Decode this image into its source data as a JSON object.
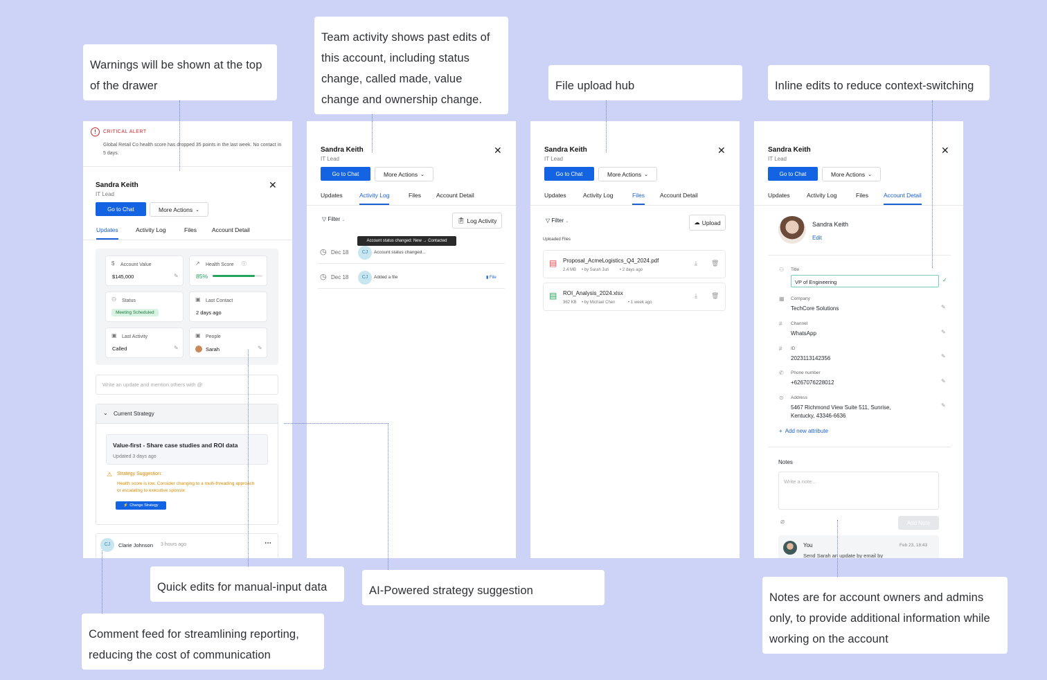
{
  "callouts": {
    "warnings": "Warnings will be shown at the top of the drawer",
    "team_activity": "Team activity shows past edits of this account, including status change, called made, value change and ownership change.",
    "file_hub": "File upload hub",
    "inline_edits": "Inline edits to reduce context-switching",
    "quick_edits": "Quick edits for manual-input data",
    "ai_strategy": "AI-Powered strategy suggestion",
    "comment_feed": "Comment feed for streamlining reporting, reducing the cost of communication",
    "notes": "Notes are for account owners and admins only, to provide additional information while working on the account"
  },
  "common": {
    "name": "Sandra Keith",
    "role": "IT Lead",
    "go_to_chat": "Go to Chat",
    "more_actions": "More Actions",
    "tabs": [
      "Updates",
      "Activity Log",
      "Files",
      "Account Detail"
    ]
  },
  "panel1": {
    "alert_title": "CRITICAL ALERT",
    "alert_text": "Global Retail Co health score has dropped 35 points in the last week. No contact in 5 days.",
    "metrics": {
      "account_value_label": "Account Value",
      "account_value": "$145,000",
      "health_label": "Health Score",
      "health_value": "85%",
      "health_fraction": 0.85,
      "status_label": "Status",
      "status_value": "Meeting Scheduled",
      "last_contact_label": "Last Contact",
      "last_contact_value": "2 days ago",
      "last_activity_label": "Last Activity",
      "last_activity_value": "Called",
      "people_label": "People",
      "people_value": "Sarah"
    },
    "update_placeholder": "Write an update and mention others with @",
    "strategy_header": "Current Strategy",
    "strategy_title": "Value-first - Share case studies and ROI data",
    "strategy_updated": "Updated 3 days ago",
    "suggestion_title": "Strategy Suggestion:",
    "suggestion_text": "Health score is low. Consider changing to a multi-threading approach or escalating to executive sponsor.",
    "change_strategy": "Change Strategy",
    "comment_initials": "CJ",
    "comment_author": "Clarie Johnson",
    "comment_time": "3 hours ago"
  },
  "panel2": {
    "filter": "Filter",
    "log_activity": "Log Activity",
    "tooltip": "Account status changed: New → Contacted",
    "entries": [
      {
        "date": "Dec 18",
        "initials": "CJ",
        "text": "Account status changed...",
        "tag": ""
      },
      {
        "date": "Dec 18",
        "initials": "CJ",
        "text": "Added a file",
        "tag": "File"
      }
    ]
  },
  "panel3": {
    "filter": "Filter",
    "upload": "Upload",
    "section": "Uploaded Files",
    "files": [
      {
        "name": "Proposal_AcmeLogistics_Q4_2024.pdf",
        "size": "2.4 MB",
        "by": "• by Sarah Jun",
        "when": "• 2 days ago",
        "color": "#e5484d"
      },
      {
        "name": "ROI_Analysis_2024.xlsx",
        "size": "362 KB",
        "by": "• by Michael Chen",
        "when": "• 1 week ago",
        "color": "#22a55a"
      }
    ]
  },
  "panel4": {
    "edit": "Edit",
    "fields": {
      "title_label": "Title",
      "title_value": "VP of Engineering",
      "company_label": "Company",
      "company_value": "TechCore Solutions",
      "channel_label": "Channel",
      "channel_value": "WhatsApp",
      "id_label": "ID",
      "id_value": "2023113142356",
      "phone_label": "Phone number",
      "phone_value": "+6267076228012",
      "address_label": "Address",
      "address_value": "5467 Richmond View Suite 511, Sunrise, Kentucky, 43346-6636"
    },
    "add_attribute": "Add new attribute",
    "notes_label": "Notes",
    "notes_placeholder": "Write a note...",
    "add_note": "Add Note",
    "note_author": "You",
    "note_time": "Feb 23, 18:43",
    "note_text": "Send Sarah an update by email by"
  },
  "colors": {
    "background": "#cdd3f7",
    "accent": "#1463e3",
    "alert": "#d0262d",
    "health": "#22a55a",
    "warning": "#d98a00"
  }
}
